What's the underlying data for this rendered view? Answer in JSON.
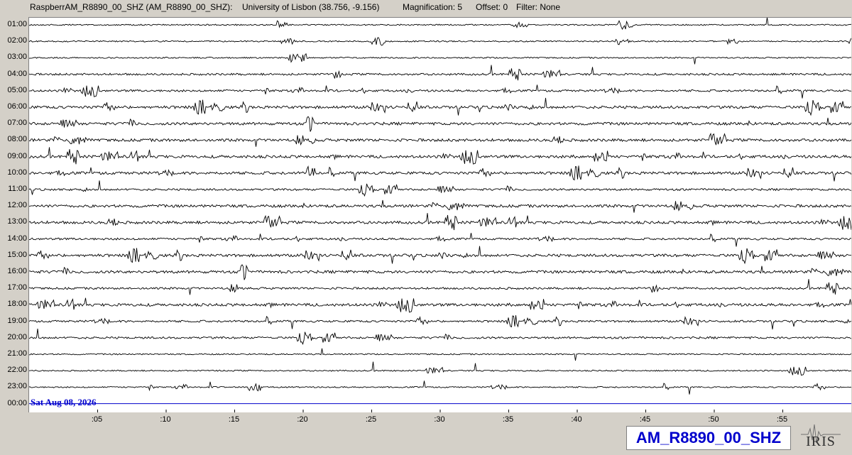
{
  "header": {
    "station": "RaspberrAM_R8890_00_SHZ (AM_R8890_00_SHZ):",
    "location": "University of Lisbon (38.756, -9.156)",
    "magnification": "Magnification: 5",
    "offset": "Offset: 0",
    "filter": "Filter: None"
  },
  "chart_data": {
    "type": "helicorder",
    "hour_labels": [
      "01:00",
      "02:00",
      "03:00",
      "04:00",
      "05:00",
      "06:00",
      "07:00",
      "08:00",
      "09:00",
      "10:00",
      "11:00",
      "12:00",
      "13:00",
      "14:00",
      "15:00",
      "16:00",
      "17:00",
      "18:00",
      "19:00",
      "20:00",
      "21:00",
      "22:00",
      "23:00",
      "00:00"
    ],
    "x_tick_labels": [
      ":05",
      ":10",
      ":15",
      ":20",
      ":25",
      ":30",
      ":35",
      ":40",
      ":45",
      ":50",
      ":55"
    ],
    "x_ticks_minutes": [
      5,
      10,
      15,
      20,
      25,
      30,
      35,
      40,
      45,
      50,
      55
    ],
    "xlim_minutes": [
      0,
      60
    ],
    "date_label": "Sat Aug 08, 2026",
    "current_line_hour": "00:00",
    "noise_level": [
      1,
      1,
      1,
      2,
      2,
      3,
      3,
      3,
      3,
      3,
      2,
      3,
      3,
      2,
      3,
      3,
      2,
      3,
      2,
      2,
      1,
      1,
      1,
      0
    ],
    "trace_color": "#000000",
    "current_trace_color": "#0000cc"
  },
  "badge": {
    "label": "AM_R8890_00_SHZ",
    "color": "#0000cc"
  },
  "logo": {
    "text": "IRIS"
  }
}
